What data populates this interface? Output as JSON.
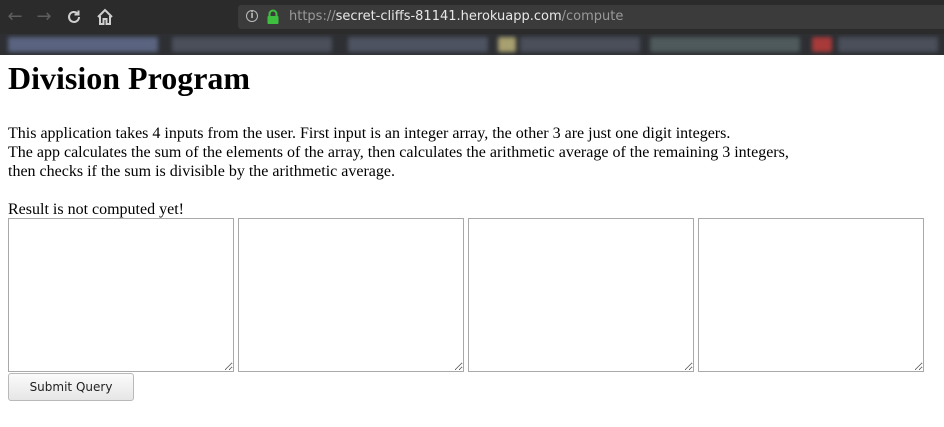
{
  "browser": {
    "icons": [
      "back-arrow-icon",
      "forward-arrow-icon",
      "reload-icon",
      "home-icon",
      "info-icon",
      "lock-icon"
    ],
    "url_scheme": "https://",
    "url_host": "secret-cliffs-81141.herokuapp.com",
    "url_path": "/compute",
    "colors": {
      "chrome": "#2b2b2b",
      "urlbar": "#3b3b3b",
      "lock": "#3fbf3f"
    }
  },
  "page": {
    "title": "Division Program",
    "description": [
      "This application takes 4 inputs from the user. First input is an integer array, the other 3 are just one digit integers.",
      "The app calculates the sum of the elements of the array, then calculates the arithmetic average of the remaining 3 integers,",
      "then checks if the sum is divisible by the arithmetic average."
    ],
    "result": "Result is not computed yet!",
    "inputs": [
      {
        "value": ""
      },
      {
        "value": ""
      },
      {
        "value": ""
      },
      {
        "value": ""
      }
    ],
    "submit_label": "Submit Query"
  }
}
